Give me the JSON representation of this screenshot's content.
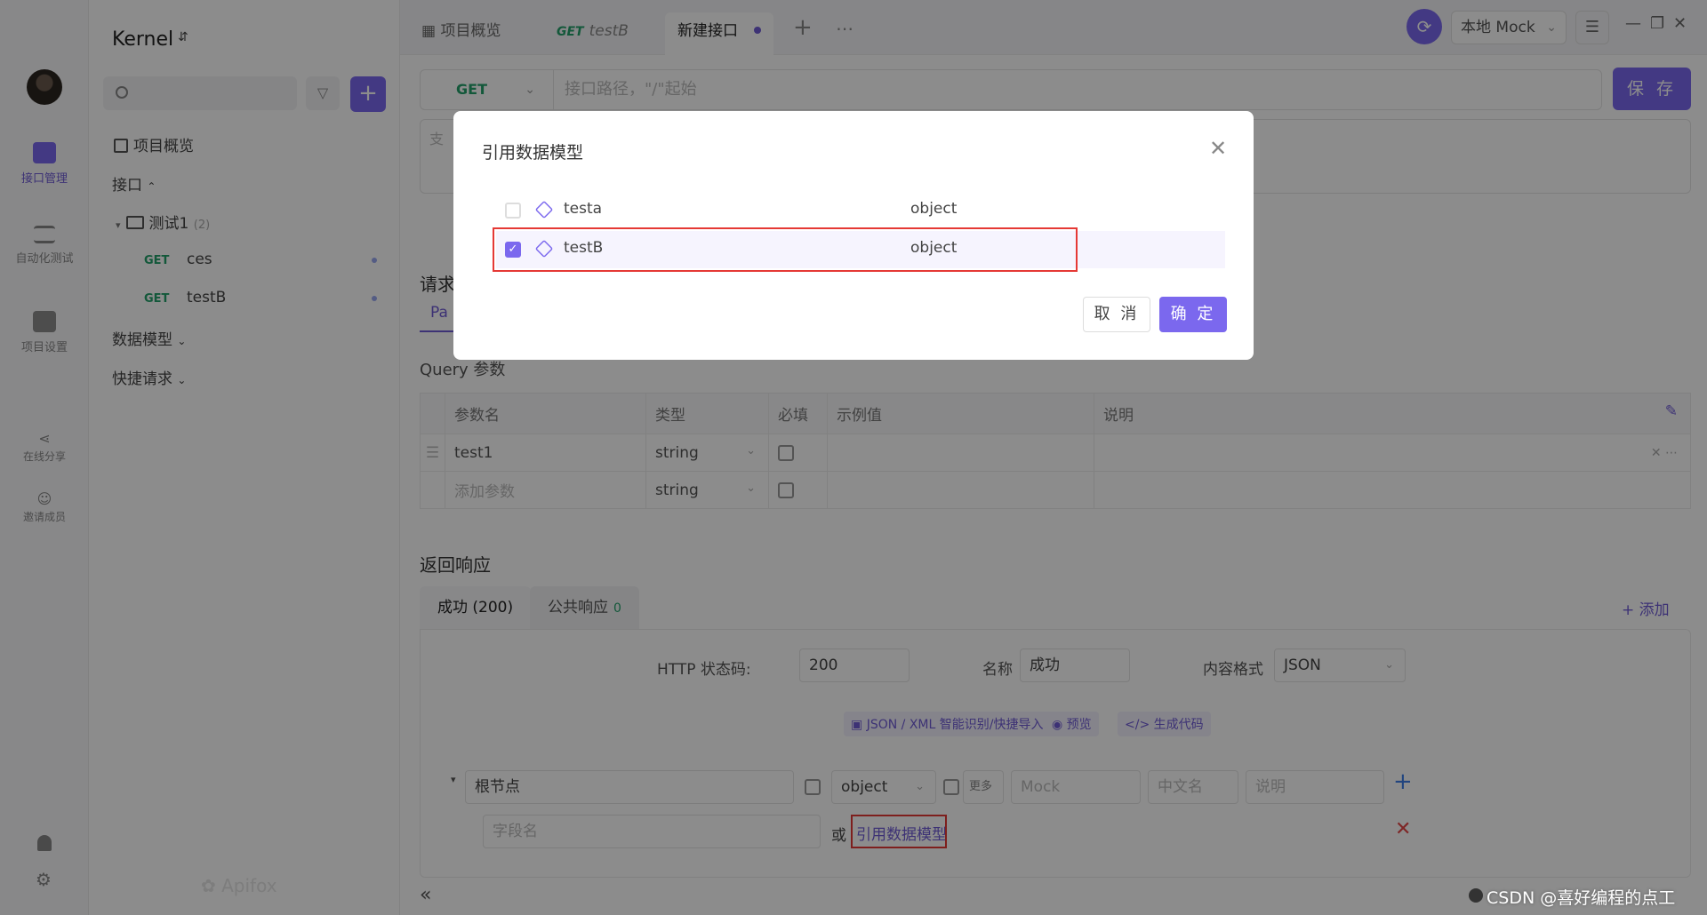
{
  "nav": {
    "items": [
      {
        "label": "接口管理",
        "icon": "api-management-icon",
        "active": true
      },
      {
        "label": "自动化测试",
        "icon": "automation-test-icon",
        "active": false
      },
      {
        "label": "项目设置",
        "icon": "project-settings-icon",
        "active": false
      }
    ],
    "share_label": "在线分享",
    "invite_label": "邀请成员"
  },
  "sidebar": {
    "project": "Kernel",
    "overview": "项目概览",
    "interfaces_label": "接口",
    "folder": {
      "name": "测试1",
      "count": "(2)"
    },
    "apis": [
      {
        "method": "GET",
        "name": "ces"
      },
      {
        "method": "GET",
        "name": "testB"
      }
    ],
    "data_models": "数据模型",
    "quick_requests": "快捷请求",
    "watermark": "Apifox"
  },
  "tabs": {
    "overview": "项目概览",
    "get_method": "GET",
    "get_name": "testB",
    "new_api": "新建接口",
    "env": "本地 Mock"
  },
  "editor": {
    "method": "GET",
    "url_placeholder": "接口路径，\"/\"起始",
    "save": "保 存",
    "desc_placeholder": "支",
    "request_title": "请求",
    "params_tab": "Pa",
    "query_title": "Query 参数",
    "columns": [
      "参数名",
      "类型",
      "必填",
      "示例值",
      "说明"
    ],
    "rows": [
      {
        "name": "test1",
        "type": "string"
      },
      {
        "name": "添加参数",
        "type": "string"
      }
    ]
  },
  "response": {
    "title": "返回响应",
    "tab_success": "成功 (200)",
    "tab_common": "公共响应",
    "tab_common_count": "0",
    "add": "+ 添加",
    "status_label": "HTTP 状态码:",
    "status_value": "200",
    "name_label": "名称",
    "name_value": "成功",
    "format_label": "内容格式",
    "format_value": "JSON",
    "tool_import": "JSON / XML 智能识别/快捷导入",
    "tool_preview": "预览",
    "tool_code": "生成代码",
    "root_node": "根节点",
    "root_type": "object",
    "more": "更多",
    "mock_ph": "Mock",
    "cn_name_ph": "中文名",
    "desc_ph": "说明",
    "field_ph": "字段名",
    "or": "或",
    "ref_model": "引用数据模型"
  },
  "modal": {
    "title": "引用数据模型",
    "items": [
      {
        "name": "testa",
        "type": "object",
        "checked": false
      },
      {
        "name": "testB",
        "type": "object",
        "checked": true
      }
    ],
    "cancel": "取 消",
    "ok": "确 定"
  },
  "footer": {
    "watermark_text": "CSDN @喜好编程的点工"
  },
  "colors": {
    "accent": "#7b68ee",
    "get_green": "#23a06b",
    "highlight_red": "#e53935"
  }
}
